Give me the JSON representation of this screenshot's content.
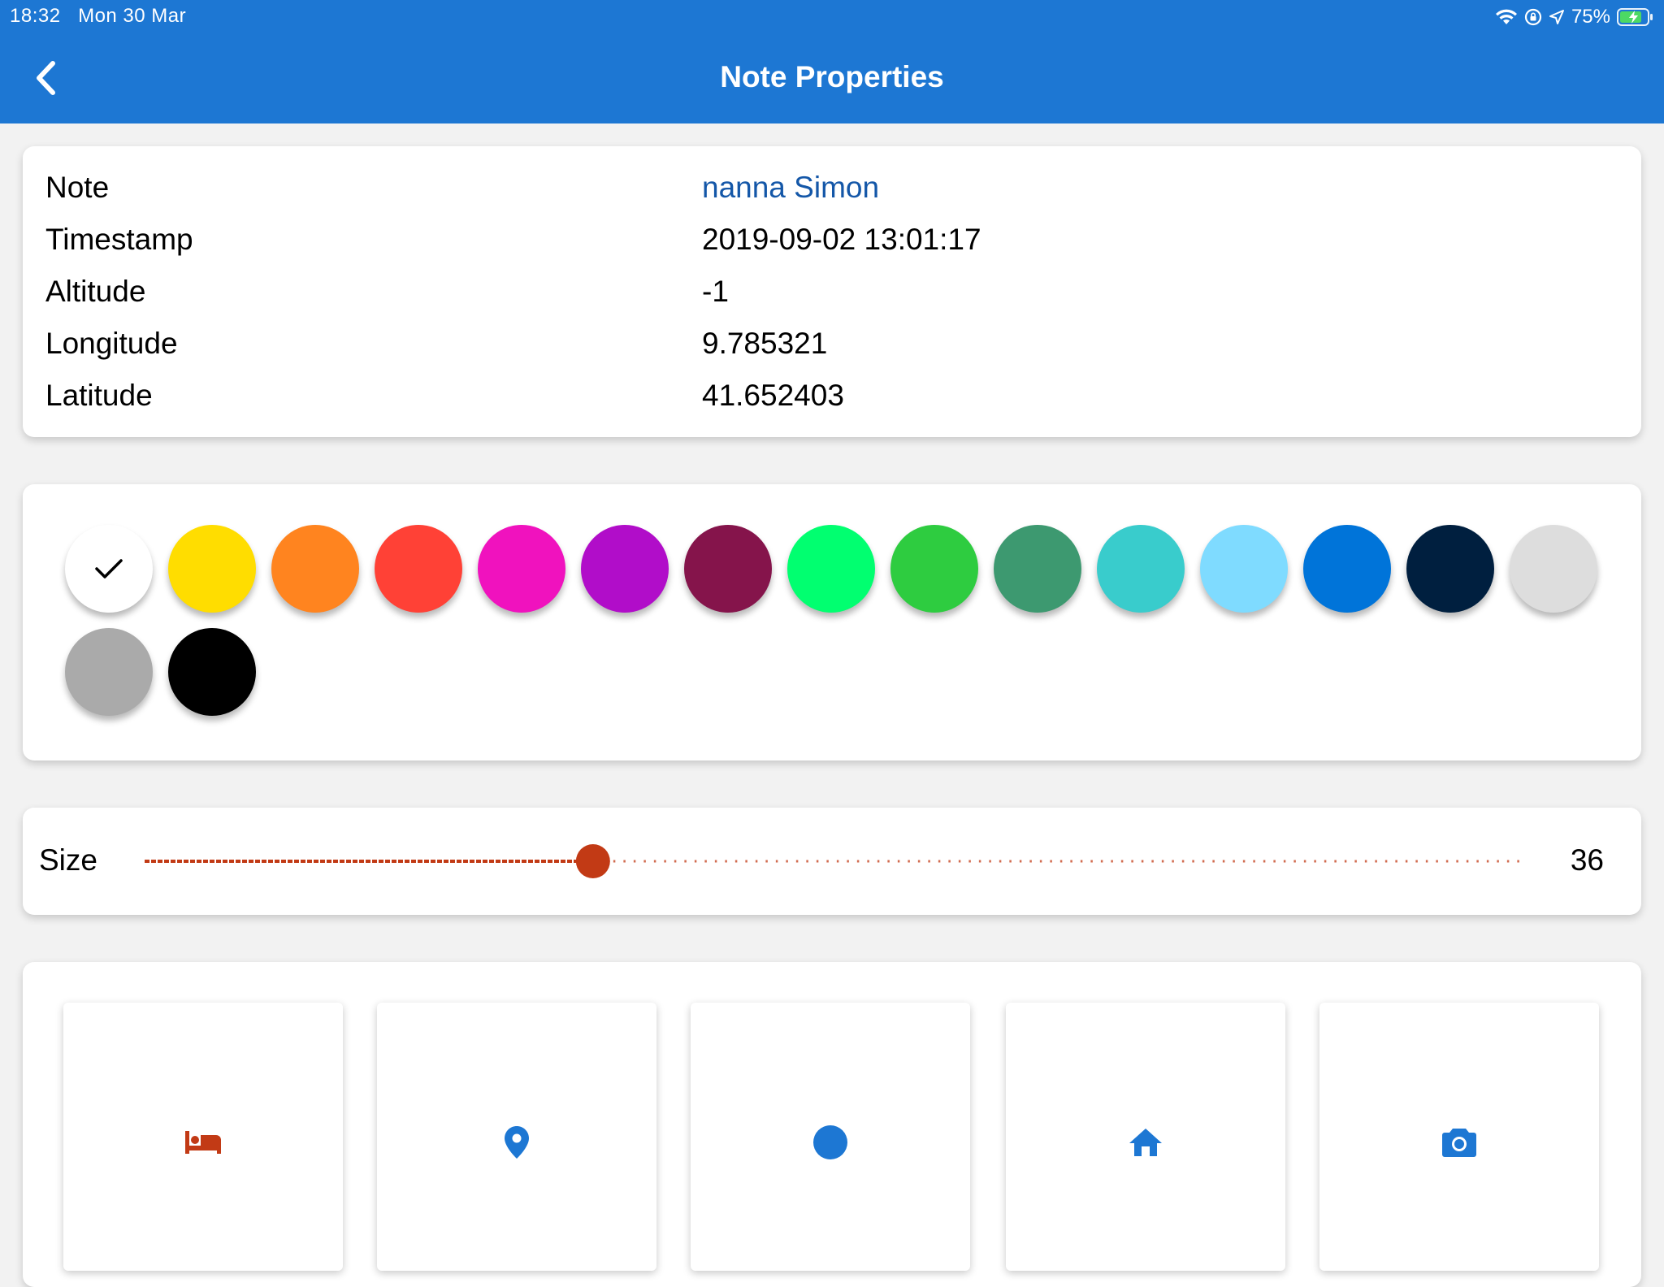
{
  "status_bar": {
    "time": "18:32",
    "date": "Mon 30 Mar",
    "battery": "75%",
    "icons": [
      "wifi-icon",
      "orientation-lock-icon",
      "location-arrow-icon",
      "battery-charging-icon"
    ]
  },
  "header": {
    "title": "Note Properties",
    "back_icon": "chevron-left-icon",
    "background": "#1d77d3"
  },
  "properties": [
    {
      "label": "Note",
      "value": "nanna Simon"
    },
    {
      "label": "Timestamp",
      "value": "2019-09-02 13:01:17"
    },
    {
      "label": "Altitude",
      "value": "-1"
    },
    {
      "label": "Longitude",
      "value": "9.785321"
    },
    {
      "label": "Latitude",
      "value": "41.652403"
    }
  ],
  "colors": {
    "selected_index": 0,
    "swatches": [
      "#ffffff",
      "#ffdd00",
      "#ff841f",
      "#ff4136",
      "#f012be",
      "#b10dc9",
      "#85144b",
      "#01ff70",
      "#2ecc40",
      "#3d9970",
      "#39cccc",
      "#7fdbff",
      "#0074d9",
      "#001f3f",
      "#dddddd",
      "#aaaaaa",
      "#000000"
    ],
    "check_icon": "checkmark-icon"
  },
  "size": {
    "label": "Size",
    "value": "36",
    "fraction": 0.325,
    "accent": "#c23a15"
  },
  "icons": [
    {
      "name": "bed-icon",
      "color": "#c23a15"
    },
    {
      "name": "map-pin-icon",
      "color": "#1d77d3"
    },
    {
      "name": "circle-icon",
      "color": "#1d77d3"
    },
    {
      "name": "home-icon",
      "color": "#1d77d3"
    },
    {
      "name": "camera-icon",
      "color": "#1d77d3"
    }
  ]
}
